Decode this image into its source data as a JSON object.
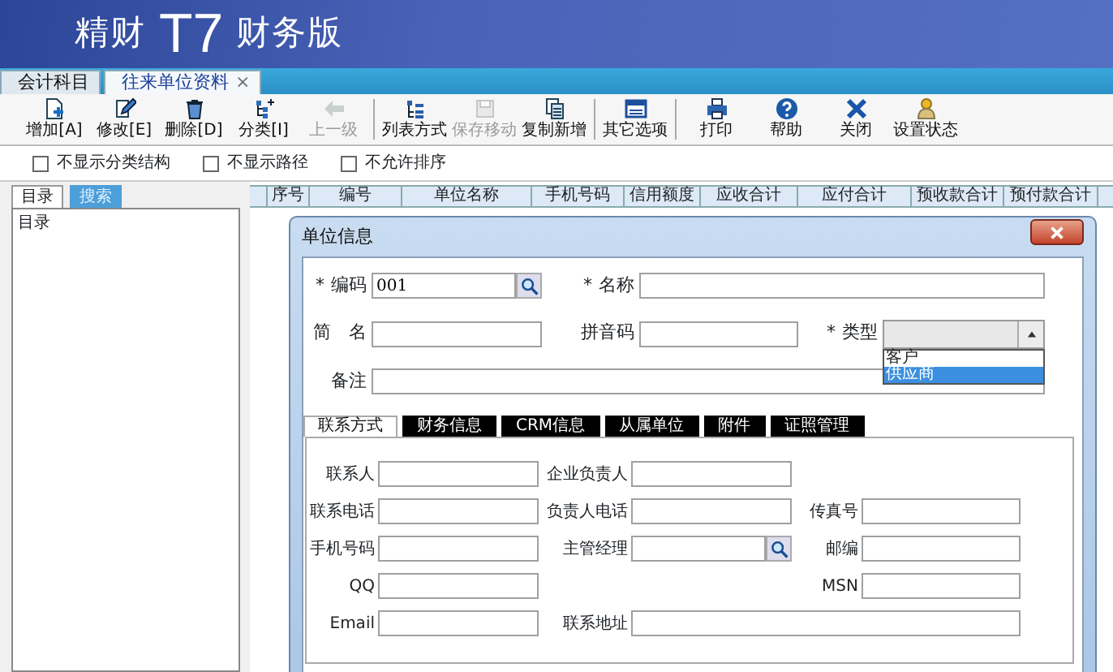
{
  "header": {
    "brand_prefix": "精财",
    "brand_mark": "T7",
    "brand_suffix": "财务版"
  },
  "document_tabs": [
    {
      "label": "会计科目",
      "selected": false
    },
    {
      "label": "往来单位资料",
      "selected": true,
      "close_glyph": "×"
    }
  ],
  "toolbar_groups": [
    [
      {
        "label": "增加[A]",
        "kind": "add",
        "disabled": false
      },
      {
        "label": "修改[E]",
        "kind": "edit",
        "disabled": false
      },
      {
        "label": "删除[D]",
        "kind": "delete",
        "disabled": false
      },
      {
        "label": "分类[I]",
        "kind": "category",
        "disabled": false
      },
      {
        "label": "上一级",
        "kind": "up",
        "disabled": true
      }
    ],
    [
      {
        "label": "列表方式",
        "kind": "list",
        "disabled": false
      },
      {
        "label": "保存移动",
        "kind": "save",
        "disabled": true
      },
      {
        "label": "复制新增",
        "kind": "copy",
        "disabled": false
      }
    ],
    [
      {
        "label": "其它选项",
        "kind": "options",
        "disabled": false
      }
    ],
    [
      {
        "label": "打印",
        "kind": "print",
        "disabled": false
      },
      {
        "label": "帮助",
        "kind": "help",
        "disabled": false
      },
      {
        "label": "关闭",
        "kind": "close",
        "disabled": false
      },
      {
        "label": "设置状态",
        "kind": "status",
        "disabled": false
      }
    ]
  ],
  "options": [
    {
      "label": "不显示分类结构",
      "checked": false
    },
    {
      "label": "不显示路径",
      "checked": false
    },
    {
      "label": "不允许排序",
      "checked": false
    }
  ],
  "side_tabs": [
    {
      "label": "目录",
      "selected": true
    },
    {
      "label": "搜索",
      "selected": false
    }
  ],
  "tree": [
    {
      "label": "目录"
    }
  ],
  "grid_columns": [
    "序号",
    "编号",
    "单位名称",
    "手机号码",
    "信用额度",
    "应收合计",
    "应付合计",
    "预收款合计",
    "预付款合计"
  ],
  "dialog": {
    "title": "单位信息",
    "main_rows": [
      [
        {
          "mark": "*",
          "label": "编码",
          "value": "001",
          "lookup": true
        },
        {
          "mark": "*",
          "label": "名称"
        }
      ],
      [
        {
          "label": "简　名"
        },
        {
          "label": "拼音码"
        },
        {
          "mark": "*",
          "label": "类型",
          "kind": "select",
          "open": true,
          "options": [
            {
              "label": "客户",
              "selected": false
            },
            {
              "label": "供应商",
              "selected": true
            }
          ]
        }
      ],
      [
        {
          "label": "备注"
        }
      ]
    ],
    "tabs": [
      {
        "label": "联系方式",
        "selected": true
      },
      {
        "label": "财务信息",
        "selected": false
      },
      {
        "label": "CRM信息",
        "selected": false
      },
      {
        "label": "从属单位",
        "selected": false
      },
      {
        "label": "附件",
        "selected": false
      },
      {
        "label": "证照管理",
        "selected": false
      }
    ],
    "contact_rows": [
      [
        {
          "label": "联系人"
        },
        {
          "label": "企业负责人"
        },
        null
      ],
      [
        {
          "label": "联系电话"
        },
        {
          "label": "负责人电话"
        },
        {
          "label": "传真号"
        }
      ],
      [
        {
          "label": "手机号码"
        },
        {
          "label": "主管经理",
          "lookup": true
        },
        {
          "label": "邮编"
        }
      ],
      [
        {
          "label": "QQ"
        },
        null,
        {
          "label": "MSN"
        }
      ],
      [
        {
          "label": "Email"
        },
        {
          "label": "联系地址"
        }
      ]
    ]
  }
}
